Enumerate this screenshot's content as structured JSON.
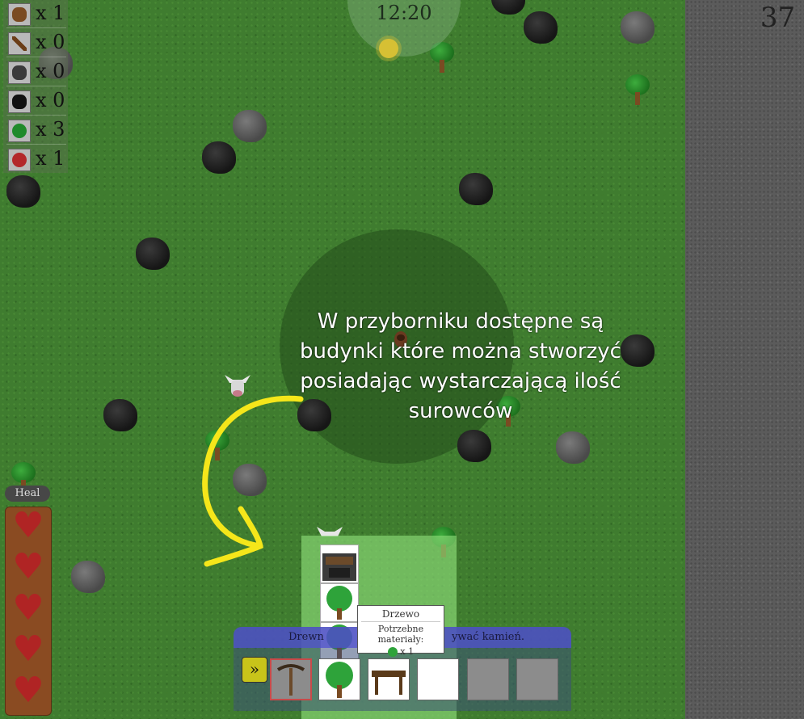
{
  "hud": {
    "clock": "12:20",
    "counter": "37"
  },
  "resources": [
    {
      "icon": "log-icon",
      "count": "x 1"
    },
    {
      "icon": "stick-icon",
      "count": "x 0"
    },
    {
      "icon": "stone-icon",
      "count": "x 0"
    },
    {
      "icon": "coal-icon",
      "count": "x 0"
    },
    {
      "icon": "sapling-icon",
      "count": "x 3"
    },
    {
      "icon": "meat-icon",
      "count": "x 1"
    }
  ],
  "health": {
    "heal_label": "Heal",
    "hearts": 5
  },
  "tutorial": {
    "text": "W przyborniku dostępne są budynki które można stworzyć posiadając wystarczającą ilość surowców"
  },
  "toolbar": {
    "message_left": "Drewn",
    "message_right": "ywać kamień.",
    "collapse_glyph": "»"
  },
  "build_menu": {
    "tooltip": {
      "title": "Drzewo",
      "materials_label": "Potrzebne materiały:",
      "material_count": "x 1"
    }
  }
}
